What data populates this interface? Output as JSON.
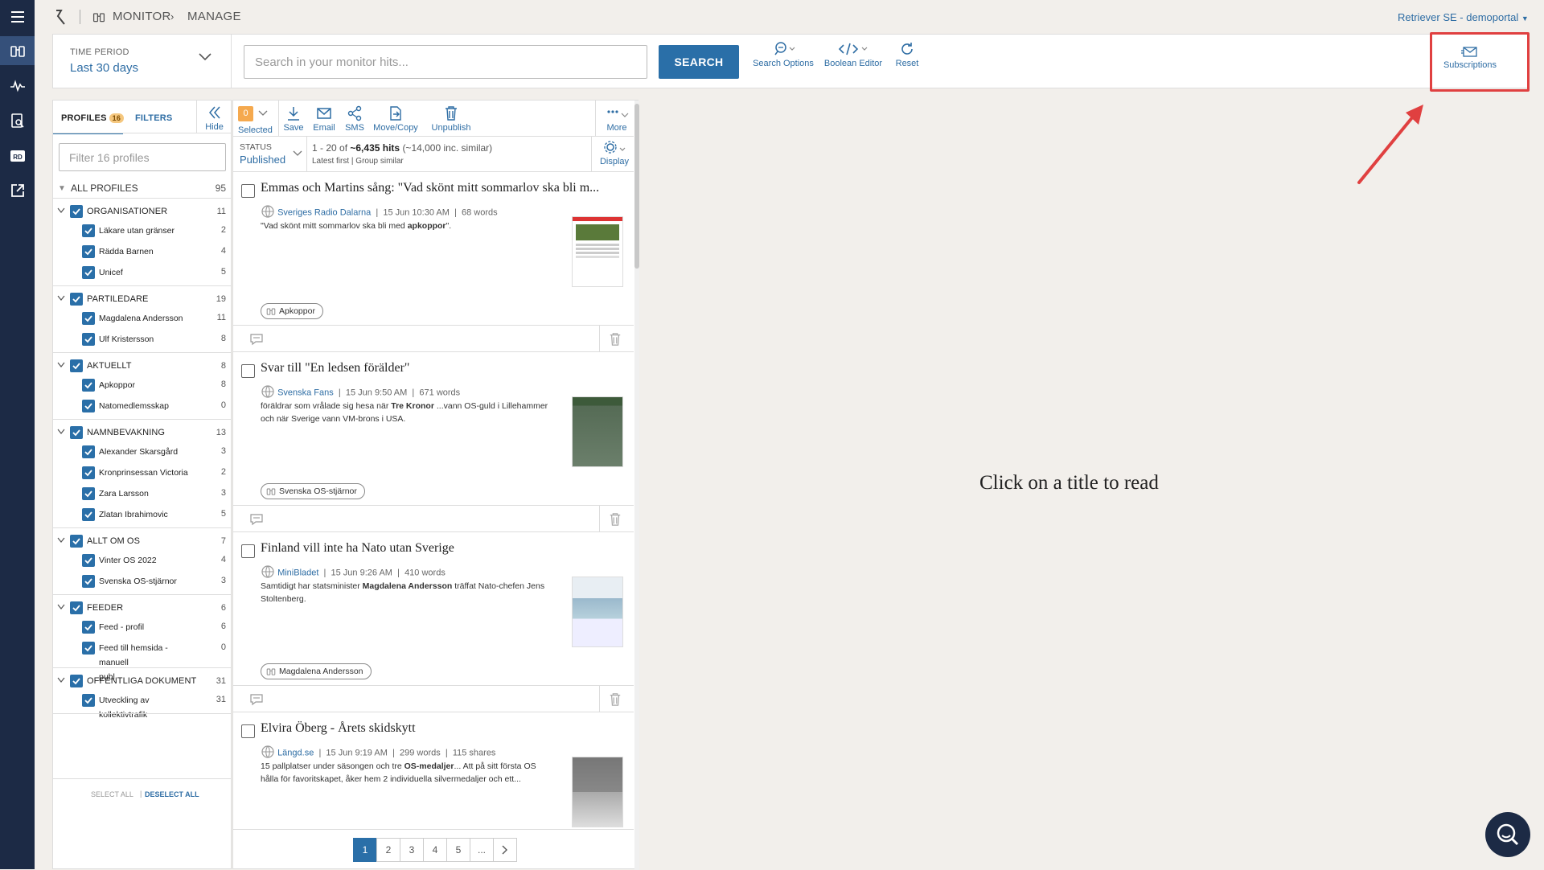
{
  "breadcrumb": {
    "section": "MONITOR",
    "page": "MANAGE"
  },
  "account": {
    "label": "Retriever SE - demoportal"
  },
  "time_period": {
    "label": "TIME PERIOD",
    "value": "Last 30 days"
  },
  "search": {
    "placeholder": "Search in your monitor hits...",
    "button": "SEARCH"
  },
  "tools": {
    "search_options": "Search Options",
    "boolean_editor": "Boolean Editor",
    "reset": "Reset",
    "subscriptions": "Subscriptions"
  },
  "profiles_panel": {
    "tab_profiles": "PROFILES",
    "profiles_count": "16",
    "tab_filters": "FILTERS",
    "hide": "Hide",
    "filter_placeholder": "Filter 16 profiles",
    "all_profiles": "ALL PROFILES",
    "all_count": "95",
    "groups": [
      {
        "name": "ORGANISATIONER",
        "count": "11",
        "items": [
          {
            "name": "Läkare utan gränser",
            "count": "2"
          },
          {
            "name": "Rädda Barnen",
            "count": "4"
          },
          {
            "name": "Unicef",
            "count": "5"
          }
        ]
      },
      {
        "name": "PARTILEDARE",
        "count": "19",
        "items": [
          {
            "name": "Magdalena Andersson",
            "count": "11"
          },
          {
            "name": "Ulf Kristersson",
            "count": "8"
          }
        ]
      },
      {
        "name": "AKTUELLT",
        "count": "8",
        "items": [
          {
            "name": "Apkoppor",
            "count": "8"
          },
          {
            "name": "Natomedlemsskap",
            "count": "0"
          }
        ]
      },
      {
        "name": "NAMNBEVAKNING",
        "count": "13",
        "items": [
          {
            "name": "Alexander Skarsgård",
            "count": "3"
          },
          {
            "name": "Kronprinsessan Victoria",
            "count": "2"
          },
          {
            "name": "Zara Larsson",
            "count": "3"
          },
          {
            "name": "Zlatan Ibrahimovic",
            "count": "5"
          }
        ]
      },
      {
        "name": "ALLT OM OS",
        "count": "7",
        "items": [
          {
            "name": "Vinter OS 2022",
            "count": "4"
          },
          {
            "name": "Svenska OS-stjärnor",
            "count": "3"
          }
        ]
      },
      {
        "name": "FEEDER",
        "count": "6",
        "items": [
          {
            "name": "Feed - profil",
            "count": "6"
          },
          {
            "name": "Feed till hemsida - manuell",
            "name2": "publ",
            "count": "0"
          }
        ]
      },
      {
        "name": "OFFENTLIGA DOKUMENT",
        "count": "31",
        "items": [
          {
            "name": "Utveckling av kollektivtrafik",
            "count": "31"
          }
        ]
      }
    ],
    "select_all": "SELECT ALL",
    "deselect_all": "DESELECT ALL"
  },
  "results_toolbar": {
    "selected_count": "0",
    "selected": "Selected",
    "save": "Save",
    "email": "Email",
    "sms": "SMS",
    "move_copy": "Move/Copy",
    "unpublish": "Unpublish",
    "more": "More"
  },
  "status": {
    "label": "STATUS",
    "value": "Published",
    "hits_prefix": "1 - 20 of",
    "hits": "~6,435 hits",
    "hits_suffix": "(~14,000 inc. similar)",
    "sort": "Latest first",
    "group": "Group similar",
    "display": "Display"
  },
  "articles": [
    {
      "title": "Emmas och Martins sång: \"Vad skönt mitt sommarlov ska bli m...",
      "source": "Sveriges Radio Dalarna",
      "date": "15 Jun 10:30 AM",
      "words": "68 words",
      "shares": "",
      "snippet_1": "\"Vad skönt mitt sommarlov ska bli med ",
      "snippet_bold": "apkoppor",
      "snippet_2": "\".",
      "tag": "Apkoppor"
    },
    {
      "title": "Svar till \"En ledsen förälder\"",
      "source": "Svenska Fans",
      "date": "15 Jun 9:50 AM",
      "words": "671 words",
      "shares": "",
      "snippet_1": "föräldrar som vrålade sig hesa när ",
      "snippet_bold": "Tre Kronor",
      "snippet_2": " ...vann OS-guld i Lillehammer och när Sverige vann VM-brons i USA.",
      "tag": "Svenska OS-stjärnor"
    },
    {
      "title": "Finland vill inte ha Nato utan Sverige",
      "source": "MiniBladet",
      "date": "15 Jun 9:26 AM",
      "words": "410 words",
      "shares": "",
      "snippet_1": "Samtidigt har statsminister ",
      "snippet_bold": "Magdalena Andersson",
      "snippet_2": " träffat Nato-chefen Jens Stoltenberg.",
      "tag": "Magdalena Andersson"
    },
    {
      "title": "Elvira Öberg - Årets skidskytt",
      "source": "Längd.se",
      "date": "15 Jun 9:19 AM",
      "words": "299 words",
      "shares": "115 shares",
      "snippet_1": "15 pallplatser under säsongen och tre ",
      "snippet_bold": "OS-medaljer",
      "snippet_2": "... Att på sitt första OS hålla för favoritskapet, åker hem 2 individuella silvermedaljer och ett...",
      "tag": ""
    }
  ],
  "pagination": [
    "1",
    "2",
    "3",
    "4",
    "5",
    "..."
  ],
  "reader": {
    "empty_message": "Click on a title to read"
  },
  "colors": {
    "rail": "#1c2a45",
    "accent": "#2a6fa8",
    "highlight": "#e04040"
  }
}
